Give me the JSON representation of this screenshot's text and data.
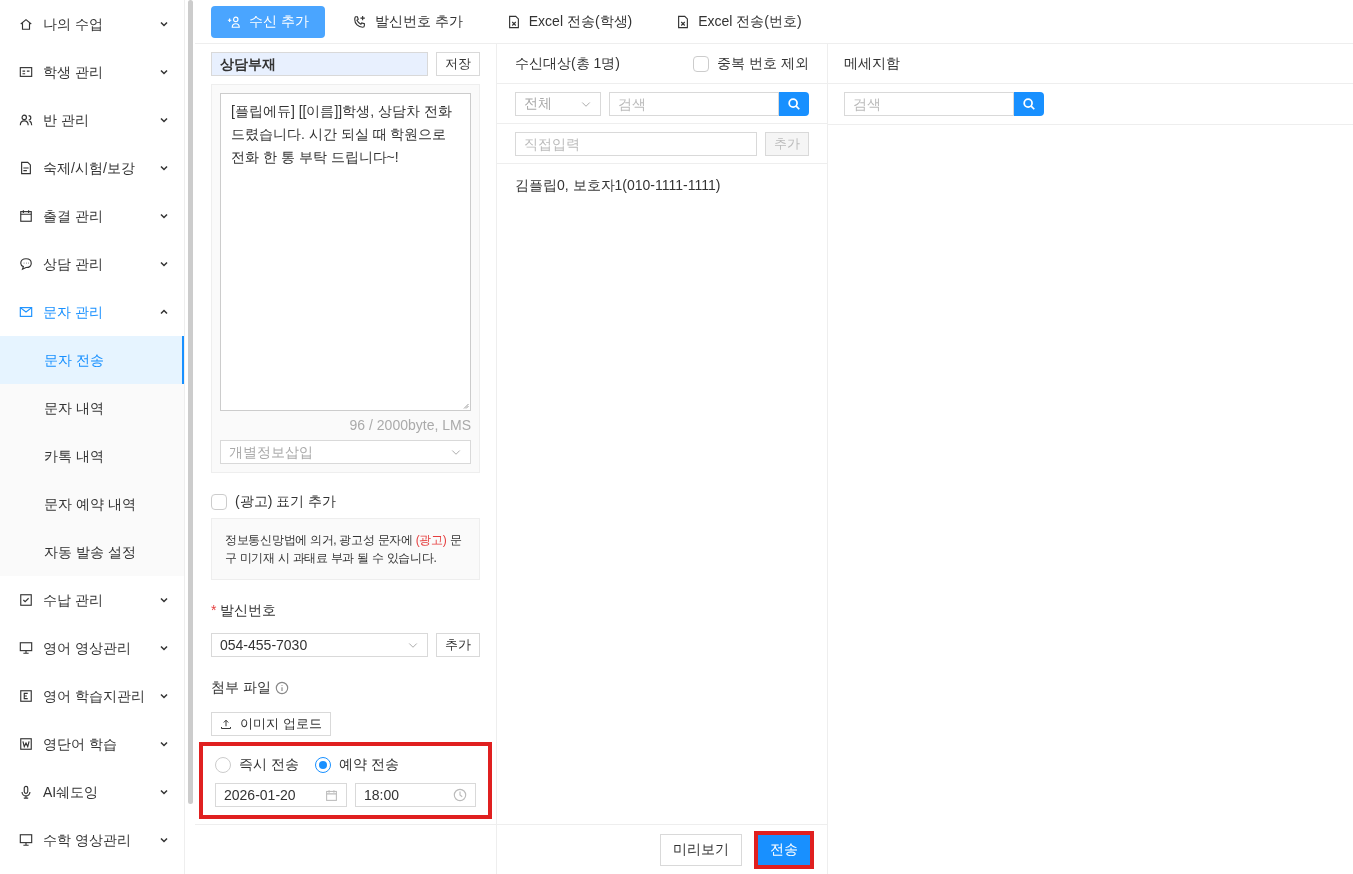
{
  "sidebar": {
    "items": [
      {
        "label": "나의 수업",
        "expanded": false
      },
      {
        "label": "학생 관리",
        "expanded": false
      },
      {
        "label": "반 관리",
        "expanded": false
      },
      {
        "label": "숙제/시험/보강",
        "expanded": false
      },
      {
        "label": "출결 관리",
        "expanded": false
      },
      {
        "label": "상담 관리",
        "expanded": false
      },
      {
        "label": "문자 관리",
        "expanded": true,
        "children": [
          {
            "label": "문자 전송",
            "selected": true
          },
          {
            "label": "문자 내역",
            "selected": false
          },
          {
            "label": "카톡 내역",
            "selected": false
          },
          {
            "label": "문자 예약 내역",
            "selected": false
          },
          {
            "label": "자동 발송 설정",
            "selected": false
          }
        ]
      },
      {
        "label": "수납 관리",
        "expanded": false
      },
      {
        "label": "영어 영상관리",
        "expanded": false
      },
      {
        "label": "영어 학습지관리",
        "expanded": false
      },
      {
        "label": "영단어 학습",
        "expanded": false
      },
      {
        "label": "AI쉐도잉",
        "expanded": false
      },
      {
        "label": "수학 영상관리",
        "expanded": false
      }
    ]
  },
  "toolbar": [
    {
      "label": "수신 추가",
      "selected": true
    },
    {
      "label": "발신번호 추가",
      "selected": false
    },
    {
      "label": "Excel 전송(학생)",
      "selected": false
    },
    {
      "label": "Excel 전송(번호)",
      "selected": false
    }
  ],
  "template": {
    "name": "상담부재",
    "save": "저장",
    "message": "[플립에듀] [[이름]]학생, 상담차 전화드렸습니다. 시간 되실 때 학원으로 전화 한 통 부탁 드립니다~!",
    "byte_count": "96 / 2000byte, LMS",
    "insert_placeholder": "개별정보삽입"
  },
  "ad": {
    "label": "(광고) 표기 추가",
    "checked": false,
    "notice_before": "정보통신망법에 의거, 광고성 문자에 ",
    "notice_highlight": "(광고)",
    "notice_after": " 문구 미기재 시 과태료 부과 될 수 있습니다."
  },
  "sender": {
    "label": "발신번호",
    "required_mark": "*",
    "value": "054-455-7030",
    "add": "추가"
  },
  "attachment": {
    "label": "첨부 파일",
    "upload": "이미지 업로드"
  },
  "schedule": {
    "highlighted": true,
    "options": [
      {
        "label": "즉시 전송",
        "selected": false
      },
      {
        "label": "예약 전송",
        "selected": true
      }
    ],
    "date": "2026-01-20",
    "time": "18:00"
  },
  "recipients": {
    "title": "수신대상(총 1명)",
    "dedupe": {
      "label": "중복 번호 제외",
      "checked": false
    },
    "filter": "전체",
    "search_placeholder": "검색",
    "direct_placeholder": "직접입력",
    "add": "추가",
    "add_disabled": true,
    "list": [
      "김플립0, 보호자1(010-1111-1111)"
    ]
  },
  "inbox": {
    "title": "메세지함",
    "search_placeholder": "검색"
  },
  "footer": {
    "preview": "미리보기",
    "send": {
      "label": "전송",
      "highlighted": true
    }
  }
}
